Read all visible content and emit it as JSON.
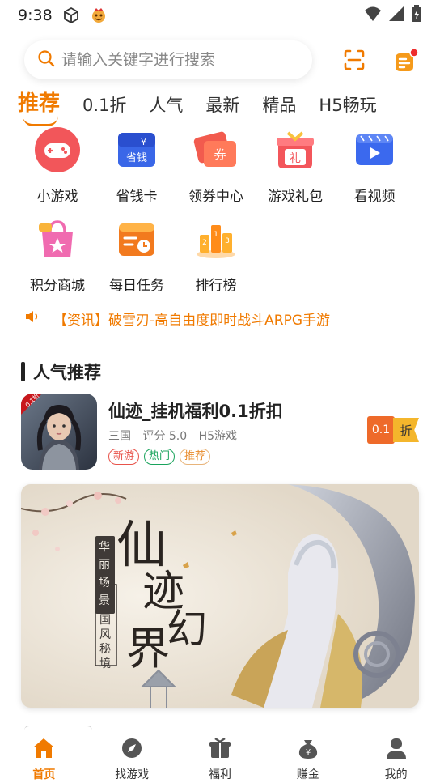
{
  "status_bar": {
    "time": "9:38"
  },
  "search": {
    "placeholder": "请输入关键字进行搜索"
  },
  "tabs": [
    {
      "label": "推荐",
      "active": true
    },
    {
      "label": "0.1折"
    },
    {
      "label": "人气"
    },
    {
      "label": "最新"
    },
    {
      "label": "精品"
    },
    {
      "label": "H5畅玩"
    }
  ],
  "grid": [
    {
      "label": "小游戏",
      "icon": "gamepad-icon"
    },
    {
      "label": "省钱卡",
      "icon": "money-card-icon",
      "icon_text": "省钱"
    },
    {
      "label": "领券中心",
      "icon": "coupon-icon",
      "icon_text": "券"
    },
    {
      "label": "游戏礼包",
      "icon": "gift-pack-icon",
      "icon_text": "礼"
    },
    {
      "label": "看视频",
      "icon": "video-icon"
    },
    {
      "label": "积分商城",
      "icon": "points-bag-icon"
    },
    {
      "label": "每日任务",
      "icon": "daily-task-icon"
    },
    {
      "label": "排行榜",
      "icon": "ranking-icon"
    }
  ],
  "news": {
    "text": "【资讯】破雪刃-高自由度即时战斗ARPG手游"
  },
  "section": {
    "title": "人气推荐"
  },
  "game": {
    "name": "仙迹_挂机福利0.1折扣",
    "icon_badge": "0.1折",
    "category": "三国",
    "rating": "评分 5.0",
    "type": "H5游戏",
    "tags": [
      "新游",
      "热门",
      "推荐"
    ],
    "discount_value": "0.1",
    "discount_unit": "折"
  },
  "banner": {
    "title_chars": [
      "仙",
      "迹",
      "幻",
      "界"
    ],
    "side_text": "华丽场景",
    "seal_text": "国风秘境"
  },
  "bottom_nav": [
    {
      "label": "首页",
      "icon": "home-icon",
      "active": true
    },
    {
      "label": "找游戏",
      "icon": "compass-icon"
    },
    {
      "label": "福利",
      "icon": "gift-icon"
    },
    {
      "label": "赚金",
      "icon": "money-bag-icon"
    },
    {
      "label": "我的",
      "icon": "user-icon"
    }
  ],
  "colors": {
    "accent": "#f07a00"
  }
}
